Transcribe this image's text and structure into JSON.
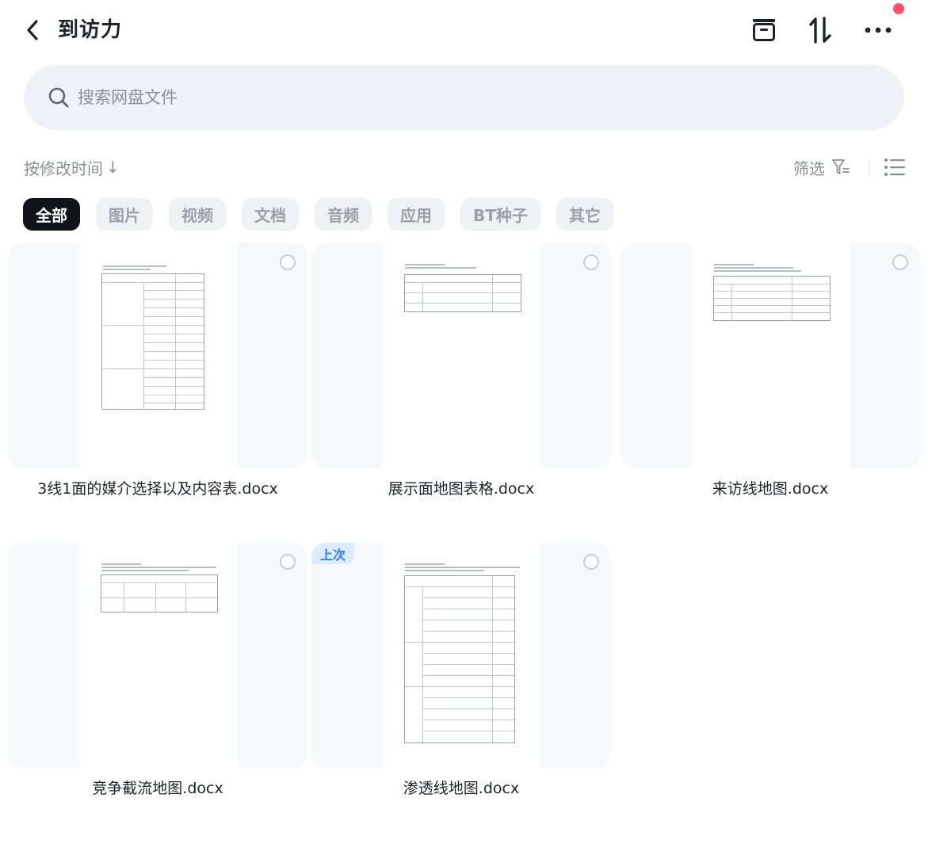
{
  "header": {
    "title": "到访力",
    "icons": [
      "chevron-left-icon",
      "archive-box-icon",
      "sort-arrows-icon",
      "more-dots-icon"
    ]
  },
  "search": {
    "placeholder": "搜索网盘文件",
    "value": ""
  },
  "toolbar": {
    "sort_label": "按修改时间",
    "sort_arrow": "↓",
    "filter_label": "筛选"
  },
  "tabs": [
    {
      "label": "全部",
      "active": true
    },
    {
      "label": "图片",
      "active": false
    },
    {
      "label": "视频",
      "active": false
    },
    {
      "label": "文档",
      "active": false
    },
    {
      "label": "音频",
      "active": false
    },
    {
      "label": "应用",
      "active": false
    },
    {
      "label": "BT种子",
      "active": false
    },
    {
      "label": "其它",
      "active": false
    }
  ],
  "files": [
    {
      "name": "3线1面的媒介选择以及内容表.docx"
    },
    {
      "name": "展示面地图表格.docx"
    },
    {
      "name": "来访线地图.docx"
    },
    {
      "name": "竞争截流地图.docx"
    },
    {
      "name": "渗透线地图.docx",
      "badge": "上次"
    }
  ],
  "colors": {
    "accent": "#2d7cf6",
    "active_tab": "#111318",
    "notify_dot": "#ff4d6a"
  }
}
